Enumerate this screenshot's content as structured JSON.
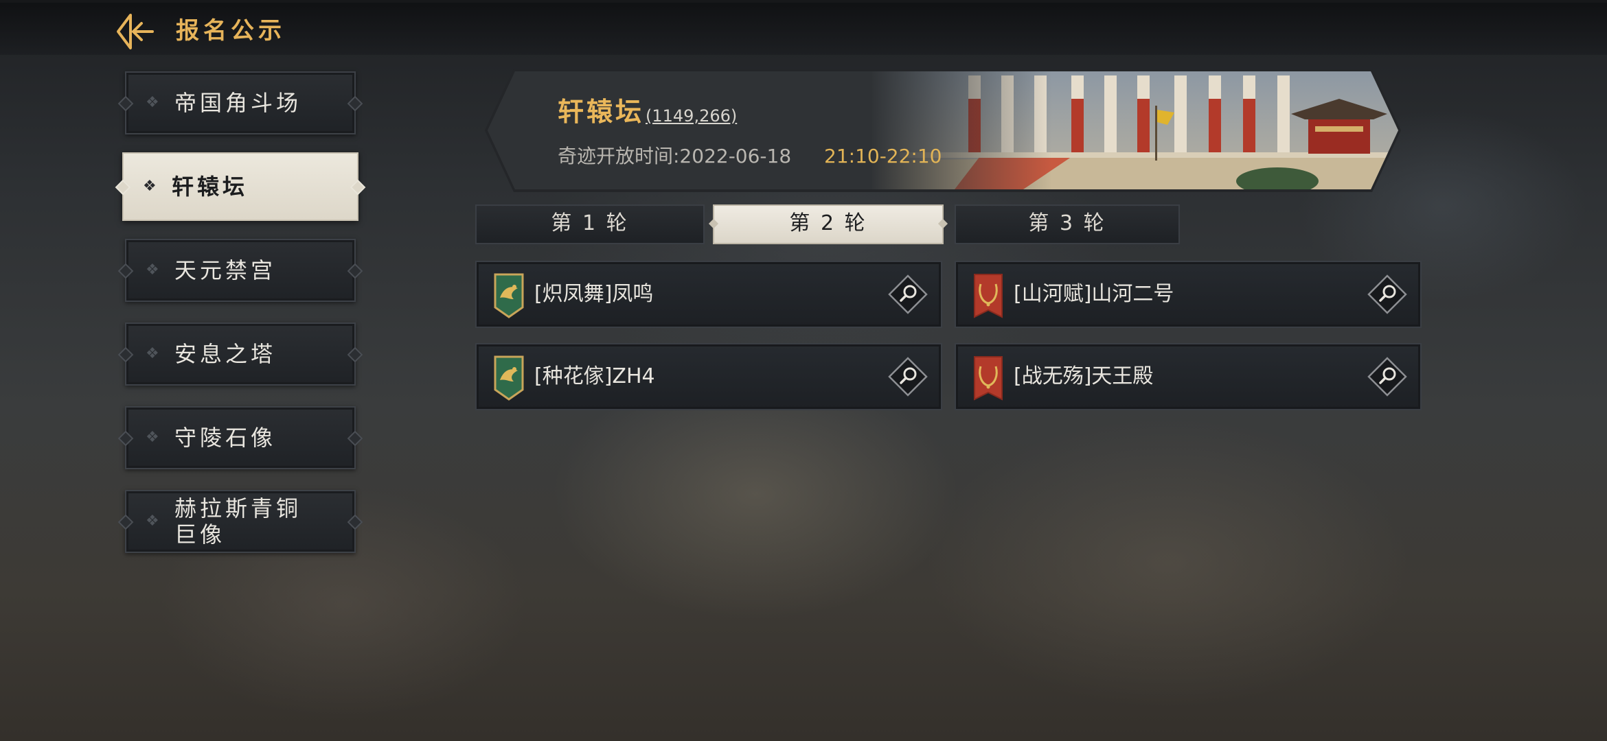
{
  "header": {
    "title": "报名公示"
  },
  "sidebar": {
    "items": [
      {
        "label": "帝国角斗场",
        "active": false
      },
      {
        "label": "轩辕坛",
        "active": true
      },
      {
        "label": "天元禁宫",
        "active": false
      },
      {
        "label": "安息之塔",
        "active": false
      },
      {
        "label": "守陵石像",
        "active": false
      },
      {
        "label": "赫拉斯青铜\n巨像",
        "active": false
      }
    ]
  },
  "banner": {
    "name": "轩辕坛",
    "coords": "(1149,266)",
    "time_label": "奇迹开放时间:2022-06-18",
    "time_range": "21:10-22:10"
  },
  "rounds": {
    "tabs": [
      {
        "label": "第 1 轮",
        "active": false
      },
      {
        "label": "第 2 轮",
        "active": true
      },
      {
        "label": "第 3 轮",
        "active": false
      }
    ]
  },
  "teams": [
    {
      "name": "[炽凤舞]凤鸣",
      "emblem": "green-phoenix-shield",
      "color": "#2f6b4a"
    },
    {
      "name": "[山河赋]山河二号",
      "emblem": "red-laurel-banner",
      "color": "#b33a2a"
    },
    {
      "name": "[种花傢]ZH4",
      "emblem": "green-phoenix-shield",
      "color": "#2f6b4a"
    },
    {
      "name": "[战无殇]天王殿",
      "emblem": "red-laurel-banner",
      "color": "#b33a2a"
    }
  ],
  "colors": {
    "accent_gold": "#e7b45a",
    "active_bg": "#e6e1d5",
    "card_bg": "#23262a"
  }
}
